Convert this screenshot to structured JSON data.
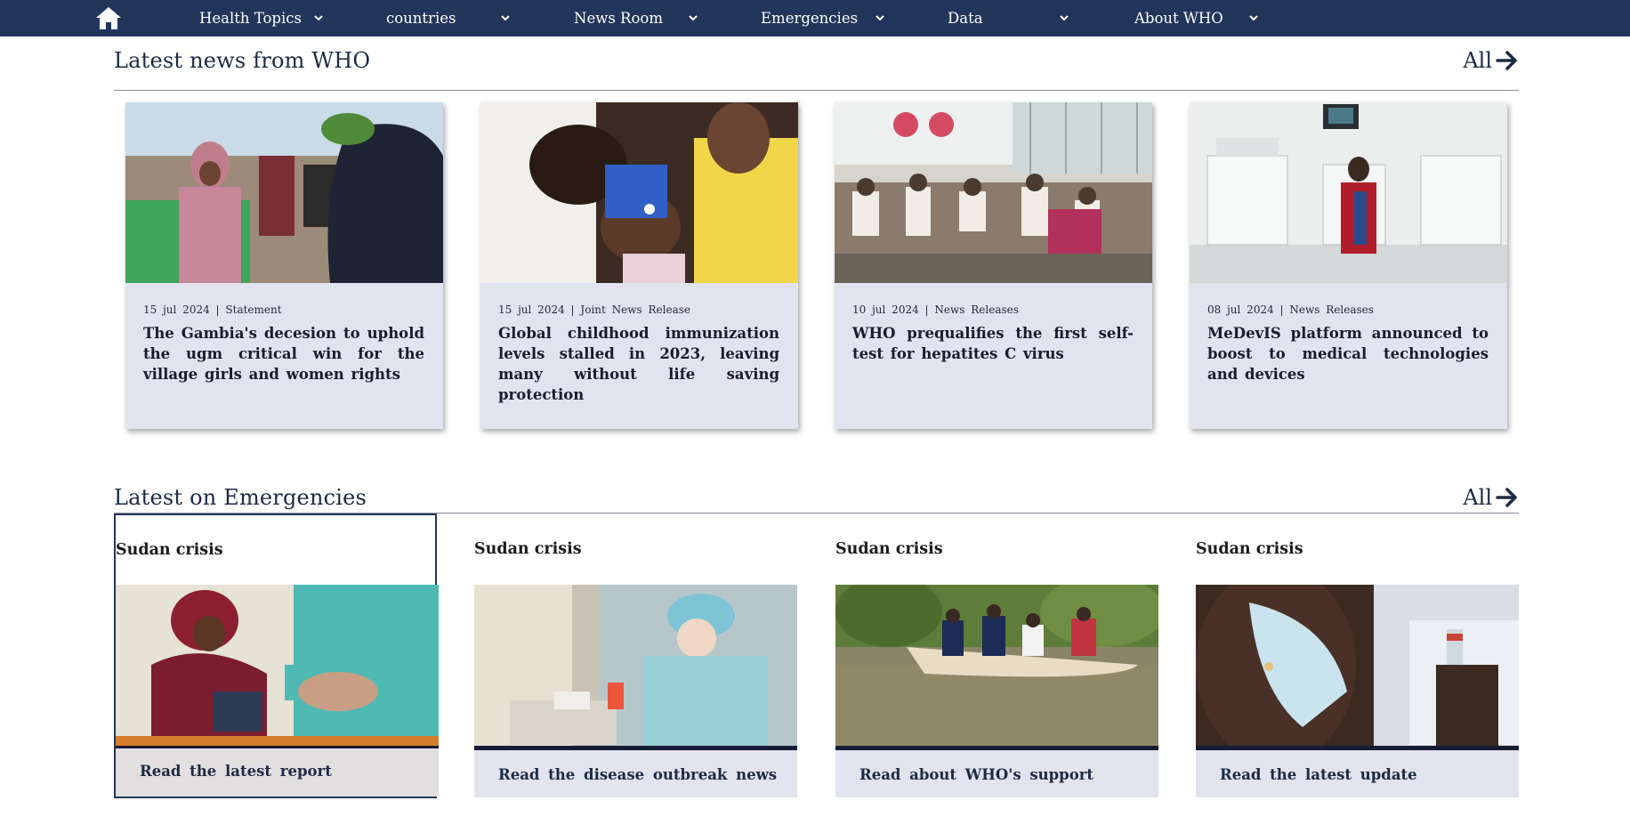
{
  "nav": {
    "home_icon": "home-icon",
    "items": [
      {
        "label": "Health Topics"
      },
      {
        "label": "countries"
      },
      {
        "label": "News Room"
      },
      {
        "label": "Emergencies"
      },
      {
        "label": "Data"
      },
      {
        "label": "About WHO"
      }
    ]
  },
  "news": {
    "heading": "Latest news from WHO",
    "all_label": "All",
    "cards": [
      {
        "date": "15 jul 2024",
        "type": "Statement",
        "title": "The Gambia's decesion to uphold the ugm critical win for the village girls and women rights"
      },
      {
        "date": "15 jul 2024",
        "type": "Joint News Release",
        "title": "Global childhood immunization levels stalled in 2023, leaving many without life saving protection"
      },
      {
        "date": "10 jul 2024",
        "type": "News Releases",
        "title": "WHO prequalifies the first self-test for hepatites C virus"
      },
      {
        "date": "08 jul 2024",
        "type": "News Releases",
        "title": "MeDevIS platform announced to boost to medical technologies and devices"
      }
    ]
  },
  "emergencies": {
    "heading": "Latest on Emergencies",
    "all_label": "All",
    "cards": [
      {
        "title": "Sudan crisis",
        "cta": "Read the latest report"
      },
      {
        "title": "Sudan crisis",
        "cta": "Read the disease outbreak news"
      },
      {
        "title": "Sudan crisis",
        "cta": "Read about WHO's support"
      },
      {
        "title": "Sudan crisis",
        "cta": "Read the latest update"
      }
    ]
  },
  "colors": {
    "nav_bg": "#22355b",
    "card_bg": "#e1e3ee",
    "accent_bar": "#161c35"
  }
}
